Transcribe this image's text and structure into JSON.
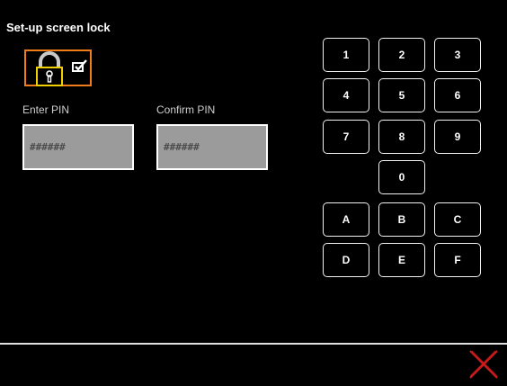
{
  "title": "Set-up screen lock",
  "icons": {
    "lock": "padlock-icon",
    "check": "checkbox-icon",
    "close": "close-icon"
  },
  "colors": {
    "accent": "#f07d1a",
    "field_bg": "#9b9b9b",
    "close": "#d01c1c"
  },
  "fields": [
    {
      "label": "Enter PIN",
      "placeholder": "######"
    },
    {
      "label": "Confirm PIN",
      "placeholder": "######"
    }
  ],
  "keypad": [
    "1",
    "2",
    "3",
    "4",
    "5",
    "6",
    "7",
    "8",
    "9",
    "0",
    "A",
    "B",
    "C",
    "D",
    "E",
    "F"
  ]
}
